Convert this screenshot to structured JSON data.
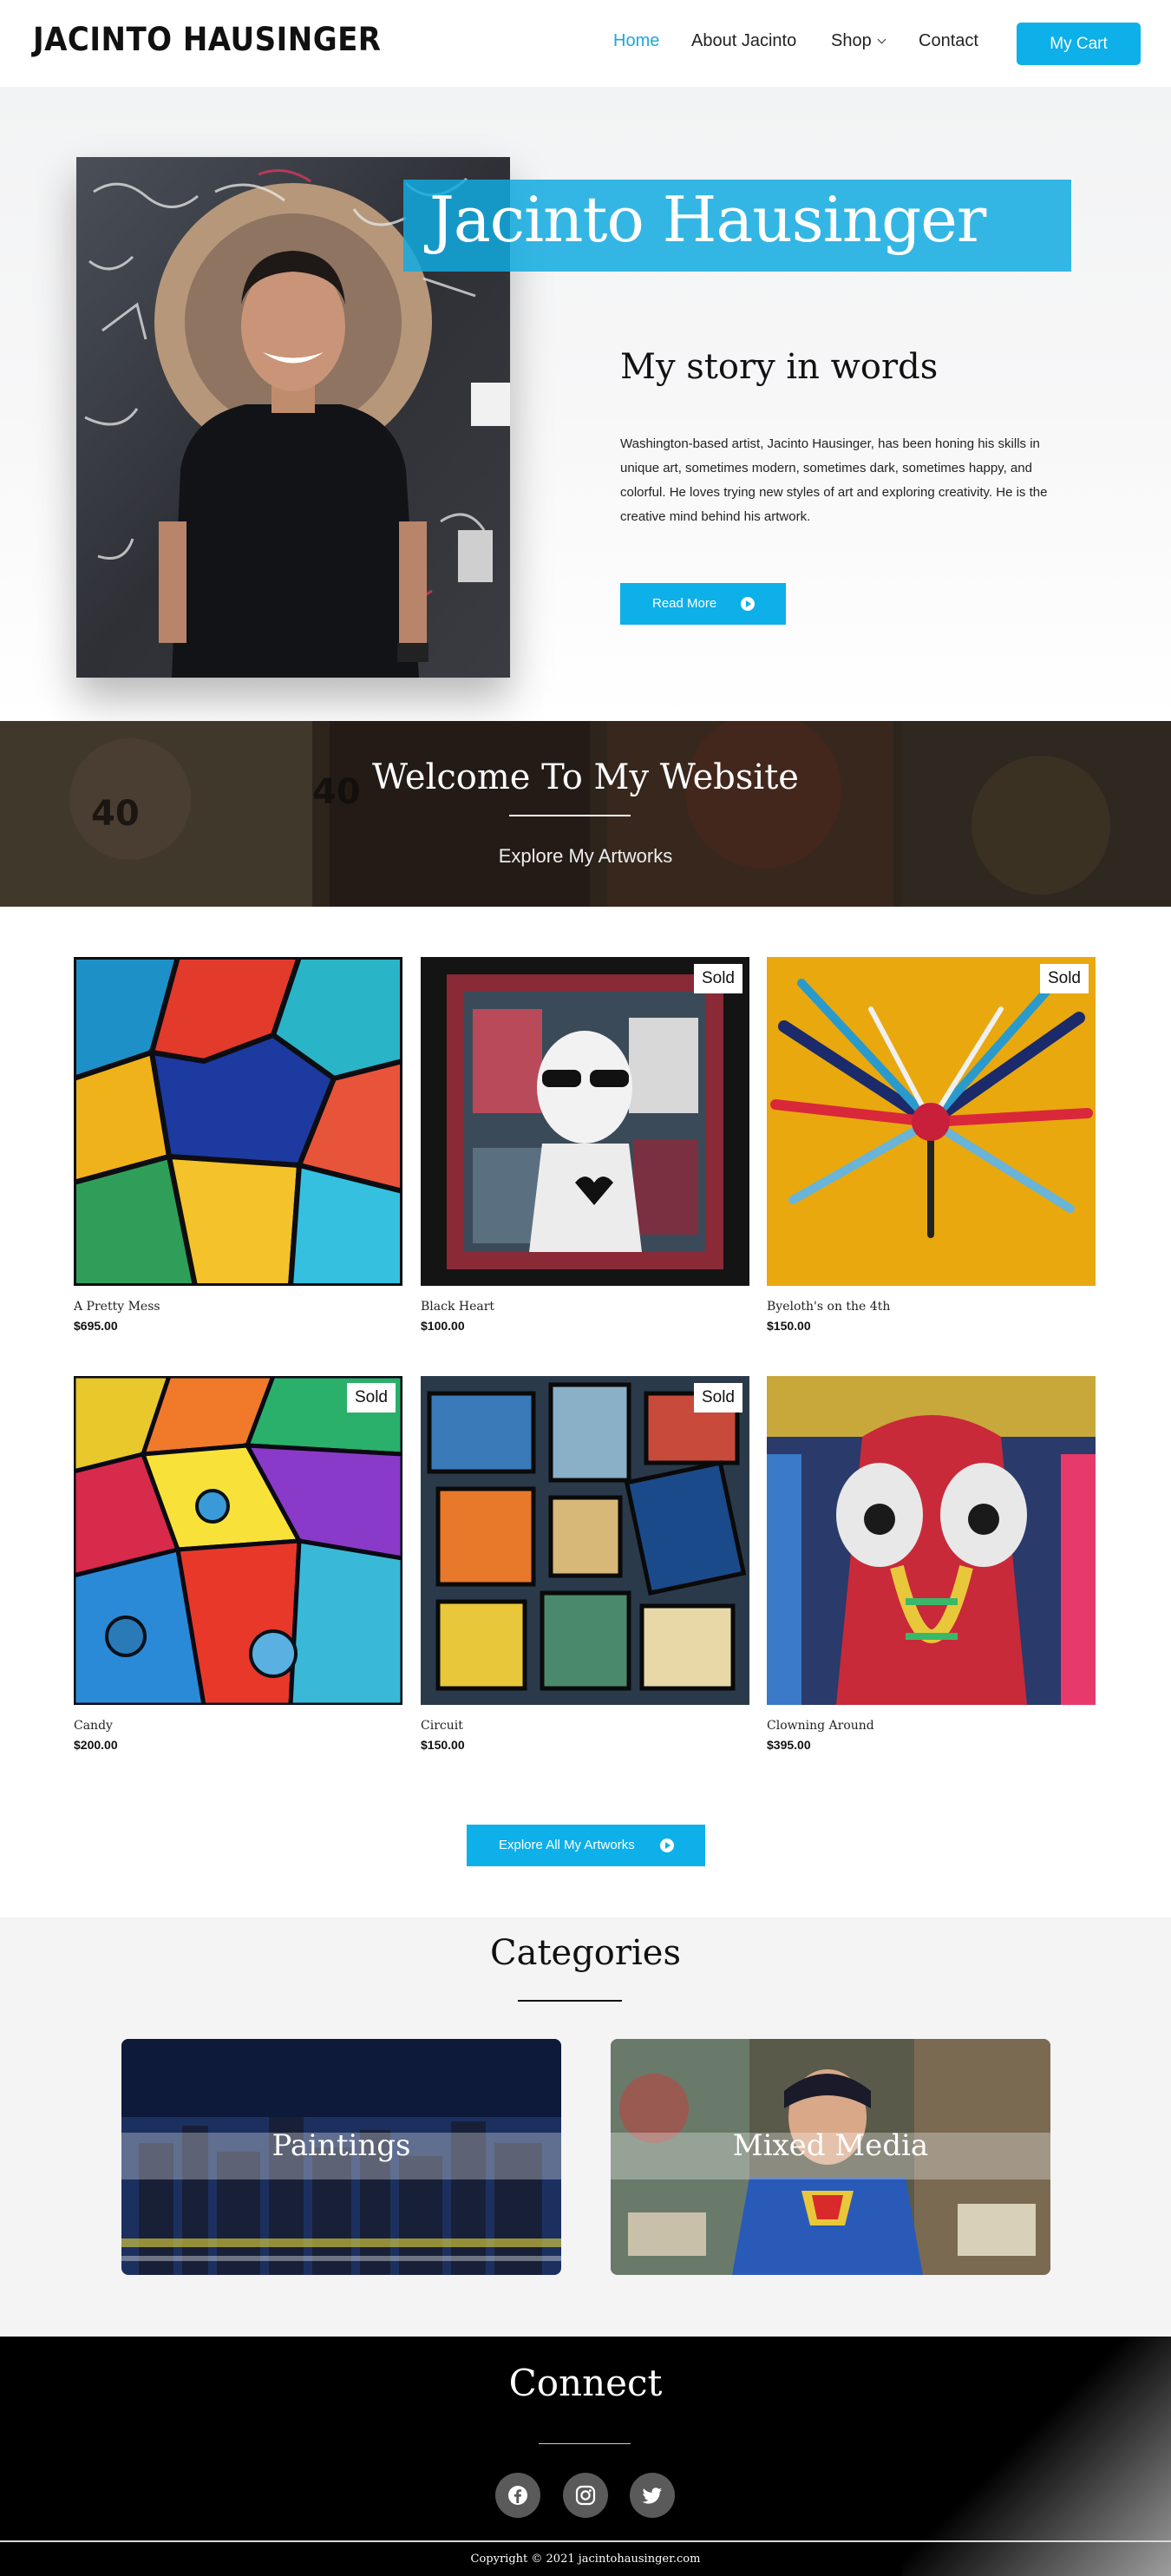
{
  "header": {
    "logo": "JACINTO HAUSINGER",
    "nav": {
      "home": "Home",
      "about": "About Jacinto",
      "shop": "Shop",
      "contact": "Contact"
    },
    "cart": "My Cart",
    "accent_color": "#0db0e8"
  },
  "hero": {
    "title": "Jacinto Hausinger",
    "story_title": "My story in words",
    "story_text": "Washington-based artist, Jacinto Hausinger, has been honing his skills in unique art, sometimes modern, sometimes dark, sometimes happy, and colorful. He loves trying new styles of art and exploring creativity. He is the creative mind behind his artwork.",
    "read_more": "Read More"
  },
  "welcome": {
    "title": "Welcome To My Website",
    "subtitle": "Explore My Artworks"
  },
  "products": [
    {
      "name": "A Pretty Mess",
      "price": "$695.00",
      "badge": ""
    },
    {
      "name": "Black Heart",
      "price": "$100.00",
      "badge": "Sold"
    },
    {
      "name": "Byeloth's on the 4th",
      "price": "$150.00",
      "badge": "Sold"
    },
    {
      "name": "Candy",
      "price": "$200.00",
      "badge": "Sold"
    },
    {
      "name": "Circuit",
      "price": "$150.00",
      "badge": "Sold"
    },
    {
      "name": "Clowning Around",
      "price": "$395.00",
      "badge": ""
    }
  ],
  "explore_all": "Explore All My Artworks",
  "categories": {
    "title": "Categories",
    "items": [
      "Paintings",
      "Mixed Media"
    ]
  },
  "footer": {
    "title": "Connect",
    "social": [
      "facebook-icon",
      "instagram-icon",
      "twitter-icon"
    ],
    "copyright": "Copyright © 2021 jacintohausinger.com"
  }
}
